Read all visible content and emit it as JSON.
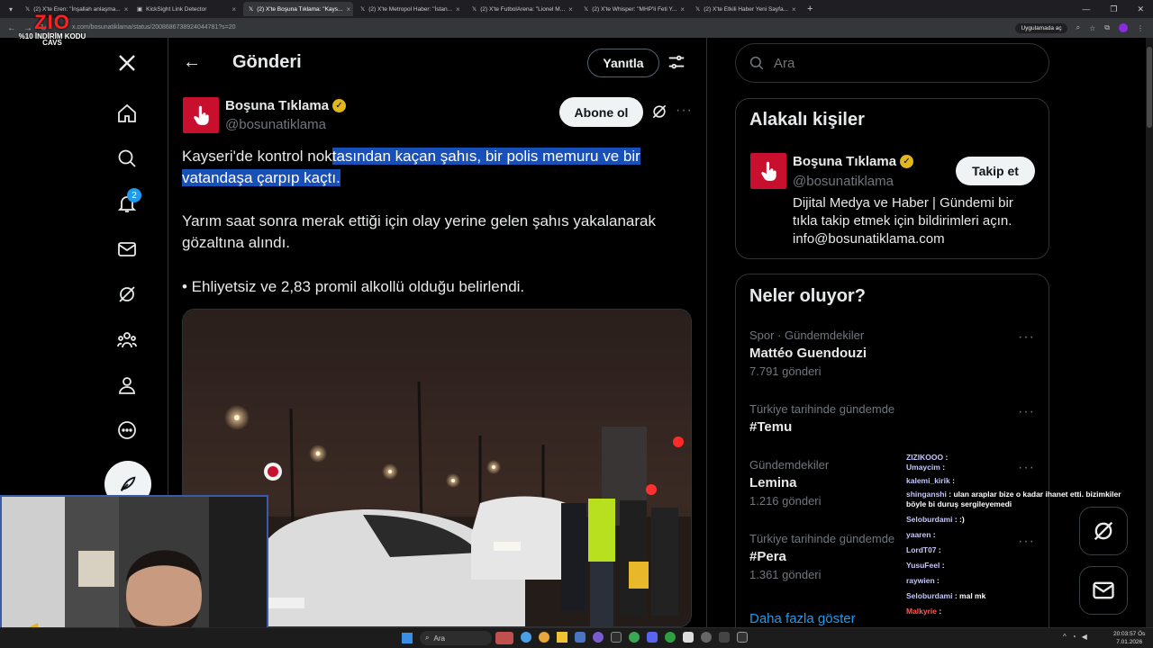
{
  "browser": {
    "tabs": [
      {
        "label": "(2) X'te Eren: \"İnşallah anlaşma...",
        "active": false
      },
      {
        "label": "KickSight Link Detector",
        "active": false
      },
      {
        "label": "(2) X'te Boşuna Tıklama: \"Kays...",
        "active": true
      },
      {
        "label": "(2) X'te Metropol Haber: \"İstan...",
        "active": false
      },
      {
        "label": "(2) X'te FutbolArena: \"Lionel M...",
        "active": false
      },
      {
        "label": "(2) X'te Whisper: \"MHP'li Feti Y...",
        "active": false
      },
      {
        "label": "(2) X'te Etkili Haber Yeni Sayfa...",
        "active": false
      }
    ],
    "new_tab": "+",
    "url": "x.com/bosunatiklama/status/2008686738924044781?s=20",
    "app_chip": "Uygulamada aç"
  },
  "stream_logo": {
    "brand": "ZIO",
    "promo_line1": "%10 İNDİRİM KODU",
    "promo_line2": "CAVS"
  },
  "nav": {
    "notifications_badge": "2"
  },
  "header": {
    "back": "←",
    "title": "Gönderi",
    "reply_button": "Yanıtla"
  },
  "post": {
    "author_name": "Boşuna Tıklama",
    "author_handle": "@bosunatiklama",
    "subscribe_button": "Abone ol",
    "text_line1_plain": "Kayseri'de kontrol nok",
    "text_line1_selected": "tasından kaçan şahıs, bir polis memuru ve bir",
    "text_line2_selected": "vatandaşa çarpıp kaçtı.",
    "paragraph2": "Yarım saat sonra merak ettiği için olay yerine gelen şahıs yakalanarak gözaltına alındı.",
    "paragraph3": "• Ehliyetsiz ve 2,83 promil alkollü olduğu belirlendi."
  },
  "search": {
    "placeholder": "Ara"
  },
  "related": {
    "title": "Alakalı kişiler",
    "name": "Boşuna Tıklama",
    "handle": "@bosunatiklama",
    "follow_button": "Takip et",
    "bio": "Dijital Medya ve Haber | Gündemi bir tıkla takip etmek için bildirimleri açın. info@bosunatiklama.com"
  },
  "trends": {
    "title": "Neler oluyor?",
    "items": [
      {
        "meta": "Spor · Gündemdekiler",
        "name": "Mattéo Guendouzi",
        "count": "7.791 gönderi"
      },
      {
        "meta": "Türkiye tarihinde gündemde",
        "name": "#Temu",
        "count": ""
      },
      {
        "meta": "Gündemdekiler",
        "name": "Lemina",
        "count": "1.216 gönderi"
      },
      {
        "meta": "Türkiye tarihinde gündemde",
        "name": "#Pera",
        "count": "1.361 gönderi"
      }
    ],
    "show_more": "Daha fazla göster"
  },
  "chat": [
    {
      "user": "ZIZIKOOO",
      "msg": ":"
    },
    {
      "user": "Umaycim",
      "msg": ":"
    },
    {
      "user": "kalemi_kirik",
      "msg": ":"
    },
    {
      "user": "shinganshi",
      "msg": ": ulan araplar bize o kadar ihanet etti. bizimkiler"
    },
    {
      "user": "",
      "msg": "böyle bi duruş sergileyemedi"
    },
    {
      "user": "Seloburdami",
      "msg": ": :)"
    },
    {
      "user": "yaaren",
      "msg": ":"
    },
    {
      "user": "LordT07",
      "msg": ":"
    },
    {
      "user": "YusuFeel",
      "msg": ":"
    },
    {
      "user": "raywien",
      "msg": ":"
    },
    {
      "user": "Seloburdami",
      "msg": ": mal mk"
    },
    {
      "user": "Malkyrie",
      "msg": ":"
    }
  ],
  "taskbar": {
    "search": "Ara",
    "time": "20:03:57 Ös",
    "date": "7.01.2026"
  },
  "colors": {
    "accent": "#1d9bf0",
    "verified": "#e2b719",
    "brand_red": "#c8102e",
    "selection": "#1750b8"
  }
}
